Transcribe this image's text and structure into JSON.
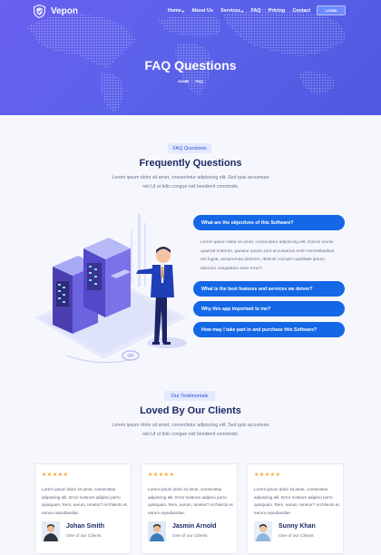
{
  "brand": {
    "name": "Vepon"
  },
  "nav": {
    "items": [
      {
        "label": "Home",
        "dropdown": "▾"
      },
      {
        "label": "About Us"
      },
      {
        "label": "Services",
        "dropdown": "▾"
      },
      {
        "label": "FAQ"
      },
      {
        "label": "Pricing"
      },
      {
        "label": "Contact"
      }
    ],
    "login_label": "LOGIN"
  },
  "hero": {
    "title": "FAQ Questions",
    "breadcrumb": [
      "HOME",
      "FAQ"
    ]
  },
  "faq": {
    "pill": "FAQ Questions",
    "title": "Frequently Questions",
    "description": "Lorem ipsum dolor sit amet, consectetur adipiscing elit. Sed quis accumsan nisi Ut ut felis congue nisl hendrerit commodo.",
    "items": [
      {
        "question": "What are the objectives of this Software?",
        "answer": "Lorem ipsum dolor sit amet, consectetur adipiscing elit. Dolore omnis quaerat nostrum, pariatur ipsam sunt accusamus enim necessitatibus est fugiat, assumenda dolorem, deleniti corrupti cupiditate ipsum, dolorum voluptatum esse error?"
      },
      {
        "question": "What is the best features and services we deiver?"
      },
      {
        "question": "Why this app important to me?"
      },
      {
        "question": "How may I take part in and purchase this Software?"
      }
    ]
  },
  "testimonials": {
    "pill": "Our Testimonials",
    "title": "Loved By Our Clients",
    "description": "Lorem ipsum dolor sit amet, consectetur adipiscing elit. Sed quis accumsan nisi Ut ut felis congue nisl hendrerit commodo.",
    "items": [
      {
        "stars": "★★★★★",
        "rating": 5,
        "quote": "Lorem ipsum dolor sit amet, consectetur adipiscing elit. Error nostrum adipisci porro quisquam. Rem, earum, tenetur? Architecto et, earum repudiandae.",
        "name": "Johan Smith",
        "role": "One of our Clients"
      },
      {
        "stars": "★★★★★",
        "rating": 5,
        "quote": "Lorem ipsum dolor sit amet, consectetur adipiscing elit. Error nostrum adipisci porro quisquam. Rem, earum, tenetur? Architecto et, earum repudiandae.",
        "name": "Jasmin Arnold",
        "role": "One of our Clients"
      },
      {
        "stars": "★★★★★",
        "rating": 5,
        "quote": "Lorem ipsum dolor sit amet, consectetur adipiscing elit. Error nostrum adipisci porro quisquam. Rem, earum, tenetur? Architecto et, earum repudiandae.",
        "name": "Sunny Khan",
        "role": "One of our Clients"
      }
    ]
  },
  "colors": {
    "accent": "#1468e6",
    "hero": "#5b62ea",
    "star": "#f5a623",
    "heading": "#1e2a66"
  },
  "icons": {
    "logo": "shield-icon",
    "rating": "star-icon"
  }
}
